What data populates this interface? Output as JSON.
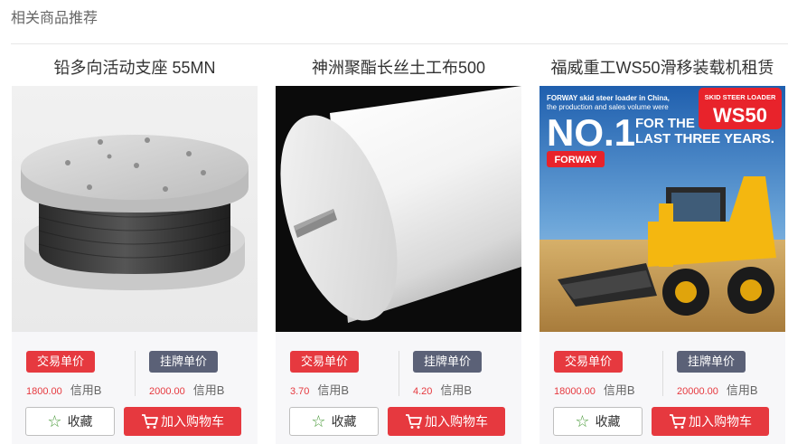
{
  "section": {
    "title": "相关商品推荐"
  },
  "products": [
    {
      "title": "铅多向活动支座 55MN",
      "trade_tag": "交易单价",
      "trade_price": "1800.00",
      "trade_unit": "信用B",
      "list_tag": "挂牌单价",
      "list_price": "2000.00",
      "list_unit": "信用B",
      "fav_label": "收藏",
      "cart_label": "加入购物车"
    },
    {
      "title": "神洲聚酯长丝土工布500",
      "trade_tag": "交易单价",
      "trade_price": "3.70",
      "trade_unit": "信用B",
      "list_tag": "挂牌单价",
      "list_price": "4.20",
      "list_unit": "信用B",
      "fav_label": "收藏",
      "cart_label": "加入购物车"
    },
    {
      "title": "福威重工WS50滑移装载机租赁",
      "trade_tag": "交易单价",
      "trade_price": "18000.00",
      "trade_unit": "信用B",
      "list_tag": "挂牌单价",
      "list_price": "20000.00",
      "list_unit": "信用B",
      "fav_label": "收藏",
      "cart_label": "加入购物车",
      "ad": {
        "top_line_1": "FORWAY  skid steer loader in China,",
        "top_line_2": "the production and sales volume were",
        "headline": "NO.1",
        "tagline_1": "FOR THE",
        "tagline_2": "LAST THREE YEARS.",
        "badge_small": "SKID STEER LOADER",
        "badge_big": "WS50",
        "logo": "FORWAY"
      }
    }
  ],
  "colors": {
    "accent": "#e6393f",
    "secondary": "#5b6177"
  }
}
